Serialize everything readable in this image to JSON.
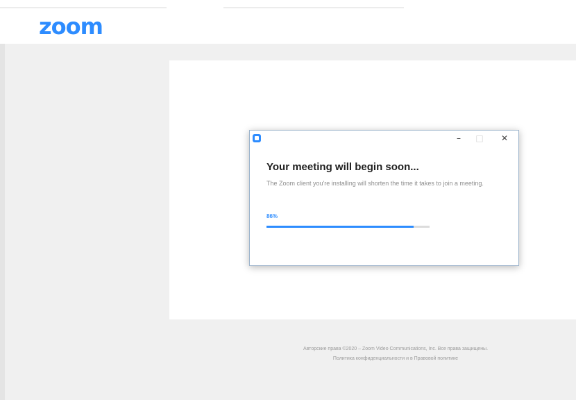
{
  "header": {
    "logo_text": "zoom"
  },
  "dialog": {
    "minimize_symbol": "–",
    "maximize_symbol": "□",
    "close_symbol": "✕",
    "title": "Your meeting will begin soon...",
    "description": "The Zoom client you're installing will shorten the time it takes to join a meeting.",
    "progress_label": "86%",
    "progress_fraction": 0.9
  },
  "footer": {
    "copyright": "Авторские права ©2020 – Zoom Video Communications, Inc. Все права защищены.",
    "links": "Политика конфиденциальности и в Правовой политике"
  },
  "colors": {
    "brand": "#2d8cff",
    "page_background": "#f0f0f0",
    "dialog_border": "#9db4cc"
  },
  "icons": [
    "zoom-app-icon",
    "minimize-icon",
    "maximize-icon",
    "close-icon"
  ]
}
